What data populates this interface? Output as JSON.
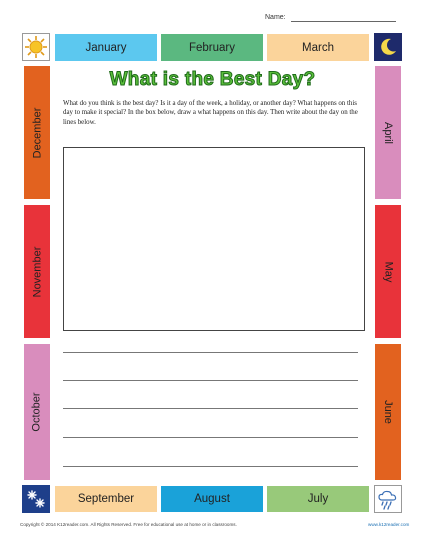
{
  "header": {
    "name_label": "Name:"
  },
  "title": "What is the Best Day?",
  "instructions": "What do you think is the best day? Is it a day of the week, a holiday, or another day? What happens on this day to make it special? In the box below, draw a what happens on this day. Then write about the day on the lines below.",
  "months": {
    "top": [
      "January",
      "February",
      "March"
    ],
    "right": [
      "April",
      "May",
      "June"
    ],
    "bottom": [
      "September",
      "August",
      "July"
    ],
    "left": [
      "December",
      "November",
      "October"
    ]
  },
  "icons": {
    "top_left": "sun-icon",
    "top_right": "moon-icon",
    "bottom_left": "snowflake-icon",
    "bottom_right": "rain-cloud-icon"
  },
  "colors": {
    "january": "#5cc8ef",
    "february": "#5bb880",
    "march": "#fbd49b",
    "april": "#d98dbd",
    "may": "#e8333a",
    "june": "#e2621f",
    "july": "#98c97a",
    "august": "#1aa2d9",
    "september": "#fbd49b",
    "october": "#d98dbd",
    "november": "#e8333a",
    "december": "#e2621f",
    "title_fill": "#5bbf3b"
  },
  "footer": {
    "copyright": "Copyright © 2014  K12reader.com. All Rights Reserved. Free for educational use at home or in classrooms.",
    "site": "www.k12reader.com"
  }
}
